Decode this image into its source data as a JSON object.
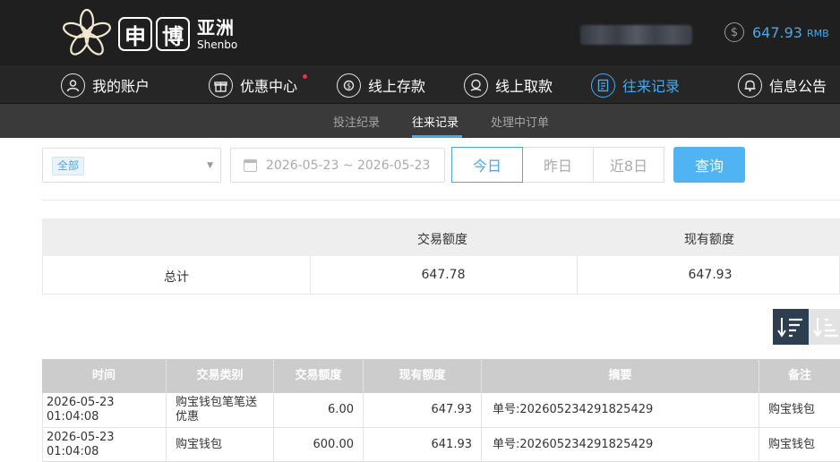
{
  "header": {
    "logo_box1": "申",
    "logo_box2": "博",
    "logo_cn": "亚洲",
    "logo_en": "Shenbo",
    "balance_amount": "647.93",
    "balance_currency": "RMB",
    "coin_icon": "$"
  },
  "nav": {
    "items": [
      {
        "label": "我的账户",
        "icon": "user-icon"
      },
      {
        "label": "优惠中心",
        "icon": "gift-icon"
      },
      {
        "label": "线上存款",
        "icon": "deposit-icon"
      },
      {
        "label": "线上取款",
        "icon": "withdraw-icon"
      },
      {
        "label": "往来记录",
        "icon": "records-icon",
        "active": true
      },
      {
        "label": "信息公告",
        "icon": "bell-icon"
      }
    ],
    "accent_color": "#4aa7e8",
    "notice_dot_color": "#e8334a"
  },
  "subnav": {
    "items": [
      "投注纪录",
      "往来记录",
      "处理中订单"
    ],
    "active_index": 1
  },
  "filters": {
    "type_selected": "全部",
    "date_range": "2026-05-23 ~ 2026-05-23",
    "quick_dates": [
      "今日",
      "昨日",
      "近8日"
    ],
    "active_quick_date": "今日",
    "query_label": "查询"
  },
  "summary": {
    "headers": [
      "",
      "交易额度",
      "现有额度"
    ],
    "row_label": "总计",
    "trade_amount": "647.78",
    "current_amount": "647.93"
  },
  "records": {
    "columns": [
      "时间",
      "交易类别",
      "交易额度",
      "现有额度",
      "摘要",
      "备注"
    ],
    "rows": [
      [
        "2026-05-23 01:04:08",
        "购宝钱包笔笔送优惠",
        "6.00",
        "647.93",
        "单号:202605234291825429",
        "购宝钱包"
      ],
      [
        "2026-05-23 01:04:08",
        "购宝钱包",
        "600.00",
        "641.93",
        "单号:202605234291825429",
        "购宝钱包"
      ]
    ]
  }
}
